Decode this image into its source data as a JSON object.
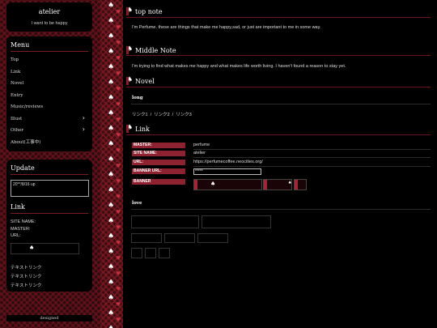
{
  "sidebar": {
    "title": "atelier",
    "tagline": "I want to be happy",
    "menu_heading": "Menu",
    "menu": [
      {
        "label": "Top",
        "has_arrow": false
      },
      {
        "label": "Link",
        "has_arrow": false
      },
      {
        "label": "Novel",
        "has_arrow": false
      },
      {
        "label": "Entry",
        "has_arrow": false
      },
      {
        "label": "Music/reviews",
        "has_arrow": false
      },
      {
        "label": "Illust",
        "has_arrow": true
      },
      {
        "label": "Other",
        "has_arrow": true
      },
      {
        "label": "About(工事中)",
        "has_arrow": false
      }
    ],
    "update_heading": "Update",
    "update_text": "20**/8/16 up",
    "link_heading": "Link",
    "link_fields": [
      "SITE NAME:",
      "MASTER:",
      "URL:"
    ],
    "text_links": [
      "テキストリンク",
      "テキストリンク",
      "テキストリンク"
    ],
    "footer": "designed"
  },
  "main": {
    "top_note": {
      "heading": "top note",
      "text": "I'm Perfume. these are things that make me happy,sad, or just are important to me in some way."
    },
    "middle_note": {
      "heading": "Middle Note",
      "text": "I'm trying to find what makes me happy and what makes life worth living. I haven't found a reason to stay yet."
    },
    "novel": {
      "heading": "Novel",
      "subheading": "long",
      "links": [
        "リンク1",
        "リンク2",
        "リンク3"
      ],
      "separator": "/"
    },
    "link": {
      "heading": "Link",
      "rows": [
        {
          "label": "MASTER:",
          "value": "perfume"
        },
        {
          "label": "SITE NAME:",
          "value": "atelier"
        },
        {
          "label": "URL:",
          "value": "https://perfumecoffee.neocities.org/"
        },
        {
          "label": "BANNER URL:",
          "value": "*****"
        },
        {
          "label": "BANNER",
          "value": ""
        }
      ],
      "love_heading": "love"
    }
  },
  "colors": {
    "accent": "#8e2231",
    "background": "#000000",
    "pattern": "#2a0a0e"
  }
}
